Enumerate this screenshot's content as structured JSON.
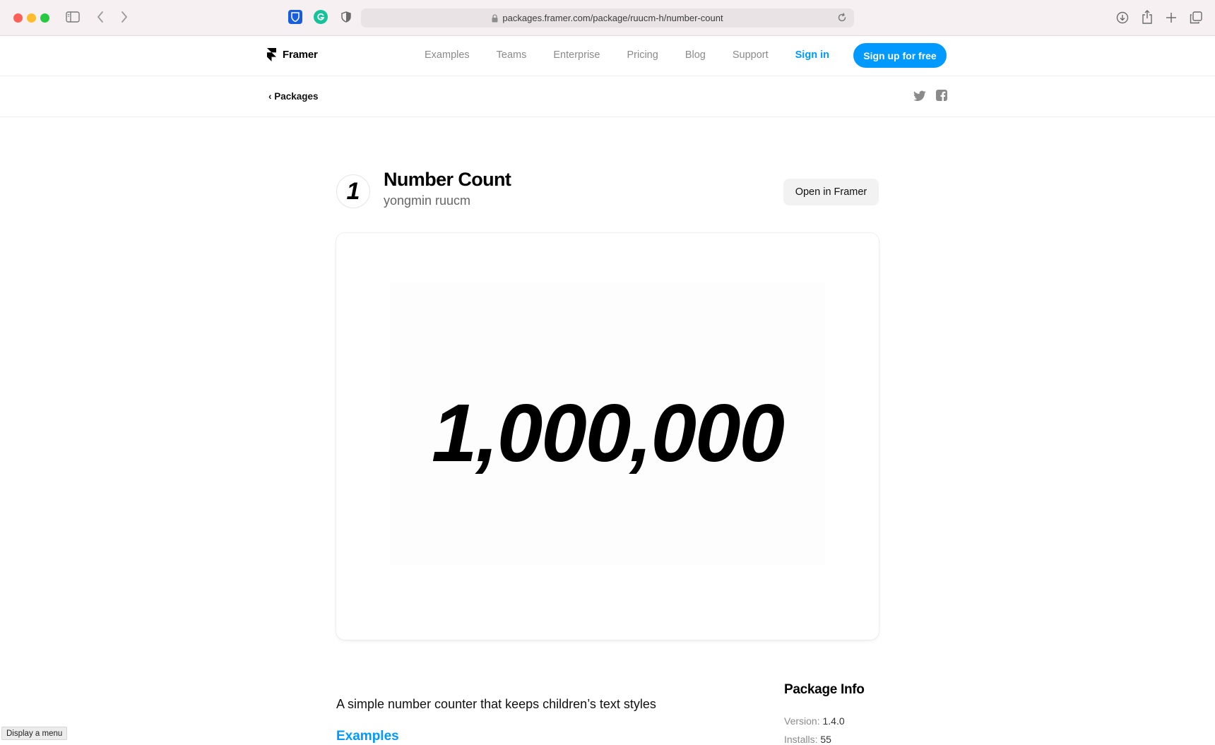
{
  "browser": {
    "url": "packages.framer.com/package/ruucm-h/number-count"
  },
  "header": {
    "logo_text": "Framer",
    "nav": {
      "examples": "Examples",
      "teams": "Teams",
      "enterprise": "Enterprise",
      "pricing": "Pricing",
      "blog": "Blog",
      "support": "Support",
      "sign_in": "Sign in"
    },
    "signup_label": "Sign up for free",
    "accent_color": "#0099ff"
  },
  "subheader": {
    "back_label": "‹ Packages"
  },
  "package": {
    "avatar_glyph": "1",
    "title": "Number Count",
    "author": "yongmin ruucm",
    "open_label": "Open in Framer",
    "preview_number": "1,000,000",
    "description": "A simple number counter that keeps children’s text styles",
    "examples_label": "Examples"
  },
  "package_info": {
    "title": "Package Info",
    "version_label": "Version:",
    "version": "1.4.0",
    "installs_label": "Installs:",
    "installs": "55"
  },
  "status_tip": "Display a menu"
}
